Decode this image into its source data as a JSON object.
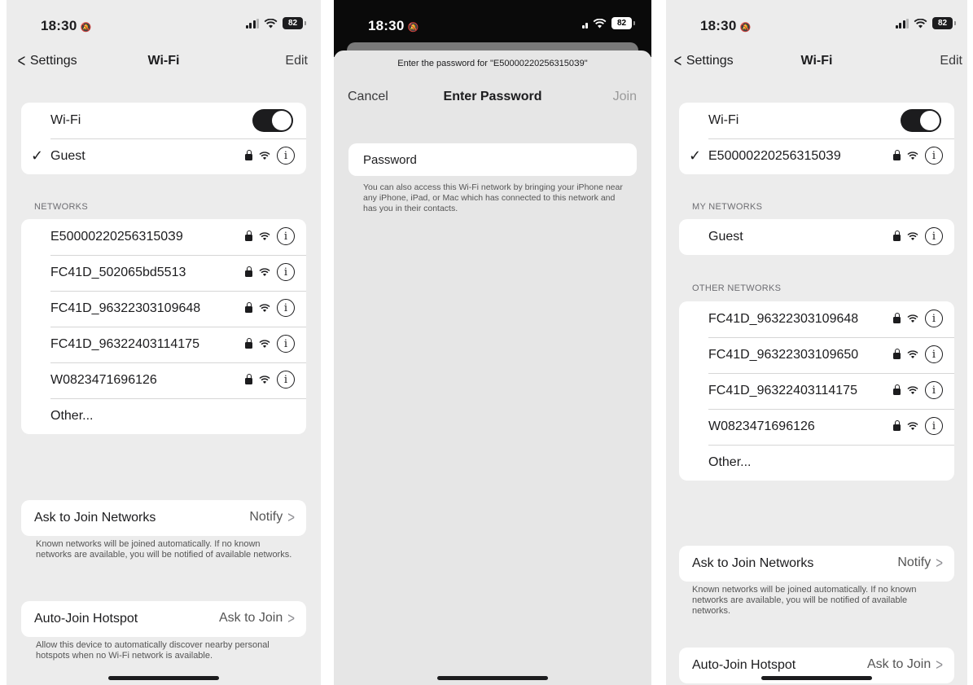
{
  "screen1": {
    "status": {
      "time": "18:30",
      "bell": "🔕",
      "battery": "82"
    },
    "nav": {
      "back_label": "Settings",
      "title": "Wi-Fi",
      "edit_label": "Edit"
    },
    "wifi_toggle_label": "Wi-Fi",
    "wifi_on": true,
    "connected_network": "Guest",
    "networks_header": "NETWORKS",
    "networks": [
      "E500002202563150З9",
      "FC41D_502065bd5513",
      "FC41D_96322303109648",
      "FC41D_96322403114175",
      "W0823471696126"
    ],
    "other_label": "Other...",
    "ask_to_join": {
      "label": "Ask to Join Networks",
      "value": "Notify"
    },
    "ask_to_join_footer": "Known networks will be joined automatically. If no known networks are available, you will be notified of available networks.",
    "auto_join": {
      "label": "Auto-Join Hotspot",
      "value": "Ask to Join"
    },
    "auto_join_footer": "Allow this device to automatically discover nearby personal hotspots when no Wi-Fi network is available."
  },
  "screen2": {
    "status": {
      "time": "18:30",
      "bell": "🔕",
      "battery": "82"
    },
    "prompt": "Enter the password for \"E500002202563150З9\"",
    "cancel_label": "Cancel",
    "title": "Enter Password",
    "join_label": "Join",
    "password_placeholder": "Password",
    "hint": "You can also access this Wi-Fi network by bringing your iPhone near any iPhone, iPad, or Mac which has connected to this network and has you in their contacts."
  },
  "screen3": {
    "status": {
      "time": "18:30",
      "bell": "🔕",
      "battery": "82"
    },
    "nav": {
      "back_label": "Settings",
      "title": "Wi-Fi",
      "edit_label": "Edit"
    },
    "wifi_toggle_label": "Wi-Fi",
    "wifi_on": true,
    "connected_network": "E500002202563150З9",
    "my_networks_header": "MY NETWORKS",
    "my_networks": [
      "Guest"
    ],
    "other_networks_header": "OTHER NETWORKS",
    "other_networks": [
      "FC41D_96322303109648",
      "FC41D_96322303109650",
      "FC41D_96322403114175",
      "W0823471696126"
    ],
    "other_label": "Other...",
    "ask_to_join": {
      "label": "Ask to Join Networks",
      "value": "Notify"
    },
    "ask_to_join_footer": "Known networks will be joined automatically. If no known networks are available, you will be notified of available networks.",
    "auto_join": {
      "label": "Auto-Join Hotspot",
      "value": "Ask to Join"
    }
  },
  "icons": {
    "check": "✓",
    "info": "i",
    "chevron_right": ">",
    "chevron_left": "<"
  }
}
